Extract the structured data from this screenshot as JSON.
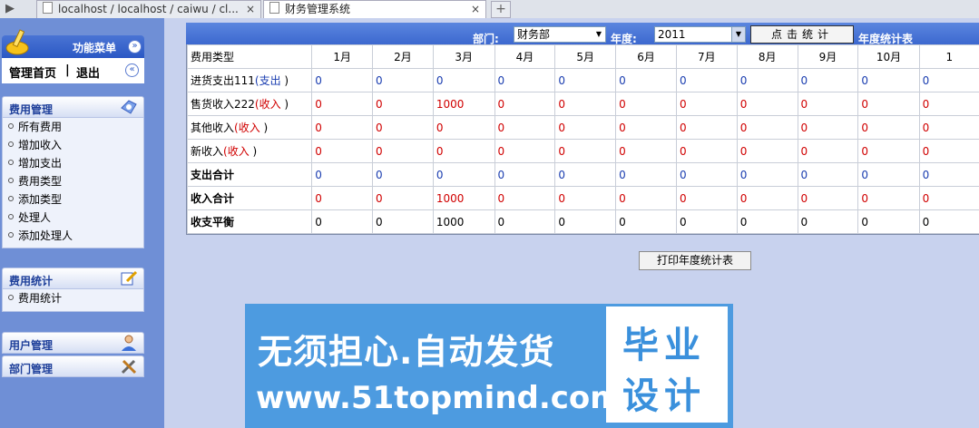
{
  "browser": {
    "tabs": [
      {
        "title": "localhost / localhost / caiwu / cl..."
      },
      {
        "title": "财务管理系统"
      }
    ],
    "new_tab": "+",
    "close": "×"
  },
  "sidebar": {
    "title": "功能菜单",
    "collapse_glyph": "»",
    "home": "管理首页",
    "separator": "|",
    "logout": "退出",
    "fold_glyph": "«",
    "sections": [
      {
        "label": "费用管理",
        "icon": "settings-hand-icon",
        "items": [
          "所有费用",
          "增加收入",
          "增加支出",
          "费用类型",
          "添加类型",
          "处理人",
          "添加处理人"
        ]
      },
      {
        "label": "费用统计",
        "icon": "edit-pencil-icon",
        "items": [
          "费用统计"
        ]
      },
      {
        "label": "用户管理",
        "icon": "user-icon",
        "items": []
      },
      {
        "label": "部门管理",
        "icon": "tools-icon",
        "items": []
      }
    ]
  },
  "toolbar": {
    "dept_label": "部门:",
    "dept_value": "财务部",
    "year_label": "年度:",
    "year_value": "2011",
    "stat_button": "点击统计",
    "report_title": "年度统计表"
  },
  "table": {
    "header_first": "费用类型",
    "months": [
      "1月",
      "2月",
      "3月",
      "4月",
      "5月",
      "6月",
      "7月",
      "8月",
      "9月",
      "10月",
      "1"
    ],
    "rows": [
      {
        "name": "进货支出111",
        "tag": "(支出",
        "tag_close": ")",
        "tag_color": "blue",
        "bold": false,
        "color": "blue",
        "values": [
          "0",
          "0",
          "0",
          "0",
          "0",
          "0",
          "0",
          "0",
          "0",
          "0",
          "0"
        ]
      },
      {
        "name": "售货收入222",
        "tag": "(收入",
        "tag_close": ")",
        "tag_color": "red",
        "bold": false,
        "color": "red",
        "values": [
          "0",
          "0",
          "1000",
          "0",
          "0",
          "0",
          "0",
          "0",
          "0",
          "0",
          "0"
        ]
      },
      {
        "name": "其他收入",
        "tag": "(收入",
        "tag_close": ")",
        "tag_color": "red",
        "bold": false,
        "color": "red",
        "values": [
          "0",
          "0",
          "0",
          "0",
          "0",
          "0",
          "0",
          "0",
          "0",
          "0",
          "0"
        ]
      },
      {
        "name": "新收入",
        "tag": "(收入",
        "tag_close": ")",
        "tag_color": "red",
        "bold": false,
        "color": "red",
        "values": [
          "0",
          "0",
          "0",
          "0",
          "0",
          "0",
          "0",
          "0",
          "0",
          "0",
          "0"
        ]
      },
      {
        "name": "支出合计",
        "tag": "",
        "tag_close": "",
        "tag_color": "",
        "bold": true,
        "color": "blue",
        "values": [
          "0",
          "0",
          "0",
          "0",
          "0",
          "0",
          "0",
          "0",
          "0",
          "0",
          "0"
        ]
      },
      {
        "name": "收入合计",
        "tag": "",
        "tag_close": "",
        "tag_color": "",
        "bold": true,
        "color": "red",
        "values": [
          "0",
          "0",
          "1000",
          "0",
          "0",
          "0",
          "0",
          "0",
          "0",
          "0",
          "0"
        ]
      },
      {
        "name": "收支平衡",
        "tag": "",
        "tag_close": "",
        "tag_color": "",
        "bold": true,
        "color": "black",
        "values": [
          "0",
          "0",
          "1000",
          "0",
          "0",
          "0",
          "0",
          "0",
          "0",
          "0",
          "0"
        ]
      }
    ]
  },
  "print_button": "打印年度统计表",
  "banner": {
    "headline": "无须担心.自动发货",
    "url": "www.51topmind.com",
    "box_line1": "毕业",
    "box_line2": "设计"
  },
  "colors": {
    "accent_blue": "#1a3db0",
    "income_red": "#d00000",
    "sidebar_bg": "#6f8fd6",
    "banner_bg": "#4d9be0"
  }
}
